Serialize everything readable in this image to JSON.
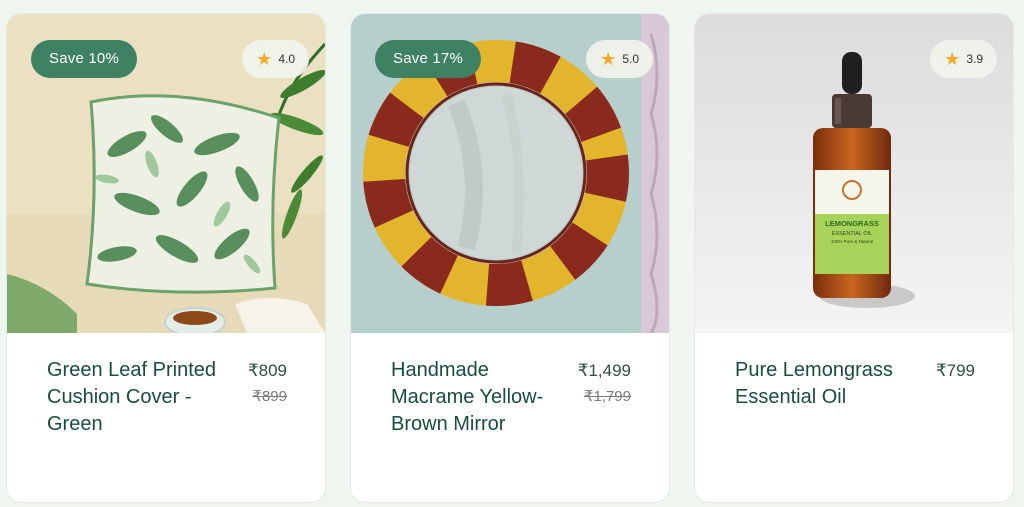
{
  "products": [
    {
      "title": "Green Leaf Printed Cushion Cover - Green",
      "save_badge": "Save 10%",
      "rating": "4.0",
      "price": "₹809",
      "old_price": "₹899",
      "icon": "star-icon"
    },
    {
      "title": "Handmade Macrame Yellow-Brown Mirror",
      "save_badge": "Save 17%",
      "rating": "5.0",
      "price": "₹1,499",
      "old_price": "₹1,799",
      "icon": "star-icon"
    },
    {
      "title": "Pure Lemongrass Essential Oil",
      "rating": "3.9",
      "price": "₹799",
      "icon": "star-icon"
    }
  ],
  "bottle_label": {
    "brand": "LEMONGRASS",
    "subtitle": "ESSENTIAL OIL",
    "line": "100% Pure & Natural"
  },
  "colors": {
    "accent": "#3f8163",
    "title": "#174d3f",
    "star": "#f5a623",
    "background": "#eff5ef"
  }
}
